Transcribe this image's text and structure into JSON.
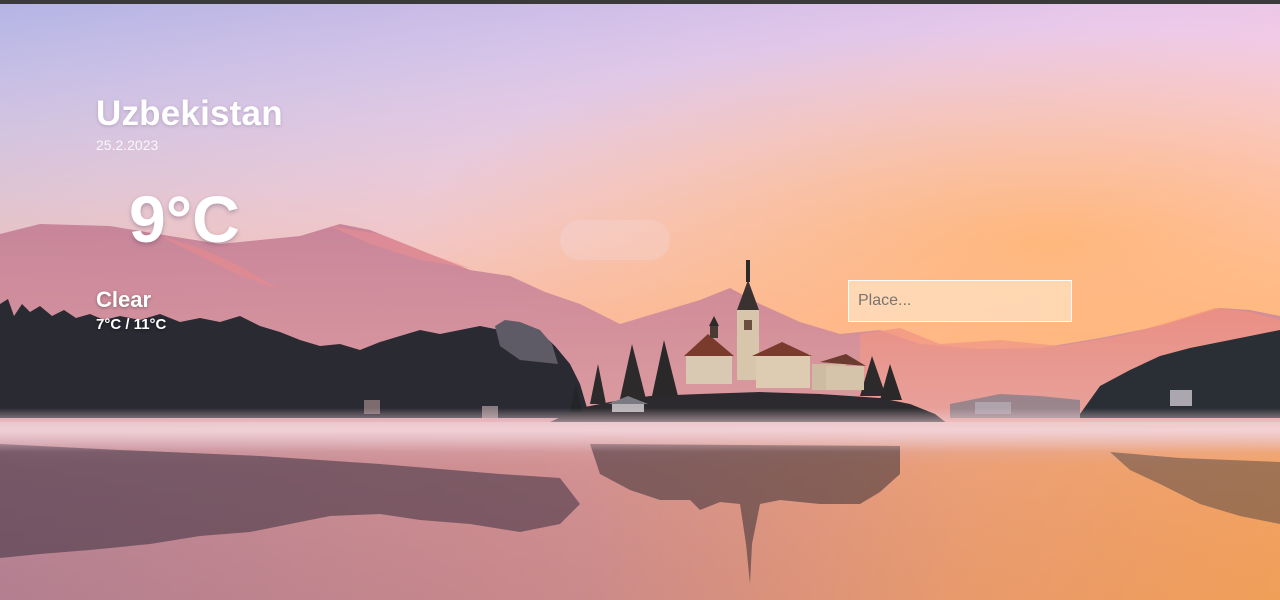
{
  "weather": {
    "location": "Uzbekistan",
    "date": "25.2.2023",
    "temperature": "9°C",
    "condition": "Clear",
    "range": "7°C / 11°C"
  },
  "search": {
    "placeholder": "Place...",
    "value": ""
  },
  "background": {
    "description_icon": "lake-church-sunrise-image",
    "sky_top": "#b7b6e6",
    "sky_horizon": "#ffc07a",
    "water": "#e3a086"
  }
}
